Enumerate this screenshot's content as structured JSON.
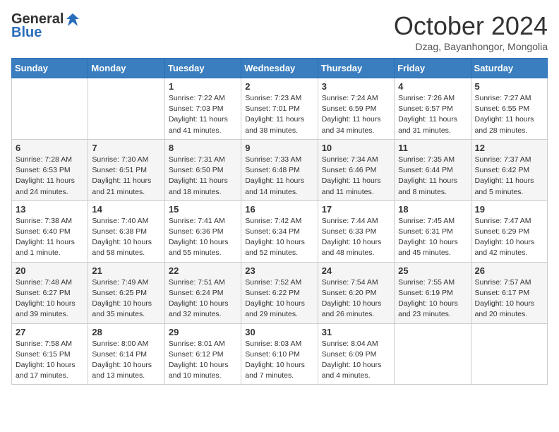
{
  "logo": {
    "general": "General",
    "blue": "Blue"
  },
  "title": "October 2024",
  "location": "Dzag, Bayanhongor, Mongolia",
  "days_header": [
    "Sunday",
    "Monday",
    "Tuesday",
    "Wednesday",
    "Thursday",
    "Friday",
    "Saturday"
  ],
  "weeks": [
    [
      {
        "day": "",
        "detail": ""
      },
      {
        "day": "",
        "detail": ""
      },
      {
        "day": "1",
        "detail": "Sunrise: 7:22 AM\nSunset: 7:03 PM\nDaylight: 11 hours and 41 minutes."
      },
      {
        "day": "2",
        "detail": "Sunrise: 7:23 AM\nSunset: 7:01 PM\nDaylight: 11 hours and 38 minutes."
      },
      {
        "day": "3",
        "detail": "Sunrise: 7:24 AM\nSunset: 6:59 PM\nDaylight: 11 hours and 34 minutes."
      },
      {
        "day": "4",
        "detail": "Sunrise: 7:26 AM\nSunset: 6:57 PM\nDaylight: 11 hours and 31 minutes."
      },
      {
        "day": "5",
        "detail": "Sunrise: 7:27 AM\nSunset: 6:55 PM\nDaylight: 11 hours and 28 minutes."
      }
    ],
    [
      {
        "day": "6",
        "detail": "Sunrise: 7:28 AM\nSunset: 6:53 PM\nDaylight: 11 hours and 24 minutes."
      },
      {
        "day": "7",
        "detail": "Sunrise: 7:30 AM\nSunset: 6:51 PM\nDaylight: 11 hours and 21 minutes."
      },
      {
        "day": "8",
        "detail": "Sunrise: 7:31 AM\nSunset: 6:50 PM\nDaylight: 11 hours and 18 minutes."
      },
      {
        "day": "9",
        "detail": "Sunrise: 7:33 AM\nSunset: 6:48 PM\nDaylight: 11 hours and 14 minutes."
      },
      {
        "day": "10",
        "detail": "Sunrise: 7:34 AM\nSunset: 6:46 PM\nDaylight: 11 hours and 11 minutes."
      },
      {
        "day": "11",
        "detail": "Sunrise: 7:35 AM\nSunset: 6:44 PM\nDaylight: 11 hours and 8 minutes."
      },
      {
        "day": "12",
        "detail": "Sunrise: 7:37 AM\nSunset: 6:42 PM\nDaylight: 11 hours and 5 minutes."
      }
    ],
    [
      {
        "day": "13",
        "detail": "Sunrise: 7:38 AM\nSunset: 6:40 PM\nDaylight: 11 hours and 1 minute."
      },
      {
        "day": "14",
        "detail": "Sunrise: 7:40 AM\nSunset: 6:38 PM\nDaylight: 10 hours and 58 minutes."
      },
      {
        "day": "15",
        "detail": "Sunrise: 7:41 AM\nSunset: 6:36 PM\nDaylight: 10 hours and 55 minutes."
      },
      {
        "day": "16",
        "detail": "Sunrise: 7:42 AM\nSunset: 6:34 PM\nDaylight: 10 hours and 52 minutes."
      },
      {
        "day": "17",
        "detail": "Sunrise: 7:44 AM\nSunset: 6:33 PM\nDaylight: 10 hours and 48 minutes."
      },
      {
        "day": "18",
        "detail": "Sunrise: 7:45 AM\nSunset: 6:31 PM\nDaylight: 10 hours and 45 minutes."
      },
      {
        "day": "19",
        "detail": "Sunrise: 7:47 AM\nSunset: 6:29 PM\nDaylight: 10 hours and 42 minutes."
      }
    ],
    [
      {
        "day": "20",
        "detail": "Sunrise: 7:48 AM\nSunset: 6:27 PM\nDaylight: 10 hours and 39 minutes."
      },
      {
        "day": "21",
        "detail": "Sunrise: 7:49 AM\nSunset: 6:25 PM\nDaylight: 10 hours and 35 minutes."
      },
      {
        "day": "22",
        "detail": "Sunrise: 7:51 AM\nSunset: 6:24 PM\nDaylight: 10 hours and 32 minutes."
      },
      {
        "day": "23",
        "detail": "Sunrise: 7:52 AM\nSunset: 6:22 PM\nDaylight: 10 hours and 29 minutes."
      },
      {
        "day": "24",
        "detail": "Sunrise: 7:54 AM\nSunset: 6:20 PM\nDaylight: 10 hours and 26 minutes."
      },
      {
        "day": "25",
        "detail": "Sunrise: 7:55 AM\nSunset: 6:19 PM\nDaylight: 10 hours and 23 minutes."
      },
      {
        "day": "26",
        "detail": "Sunrise: 7:57 AM\nSunset: 6:17 PM\nDaylight: 10 hours and 20 minutes."
      }
    ],
    [
      {
        "day": "27",
        "detail": "Sunrise: 7:58 AM\nSunset: 6:15 PM\nDaylight: 10 hours and 17 minutes."
      },
      {
        "day": "28",
        "detail": "Sunrise: 8:00 AM\nSunset: 6:14 PM\nDaylight: 10 hours and 13 minutes."
      },
      {
        "day": "29",
        "detail": "Sunrise: 8:01 AM\nSunset: 6:12 PM\nDaylight: 10 hours and 10 minutes."
      },
      {
        "day": "30",
        "detail": "Sunrise: 8:03 AM\nSunset: 6:10 PM\nDaylight: 10 hours and 7 minutes."
      },
      {
        "day": "31",
        "detail": "Sunrise: 8:04 AM\nSunset: 6:09 PM\nDaylight: 10 hours and 4 minutes."
      },
      {
        "day": "",
        "detail": ""
      },
      {
        "day": "",
        "detail": ""
      }
    ]
  ]
}
